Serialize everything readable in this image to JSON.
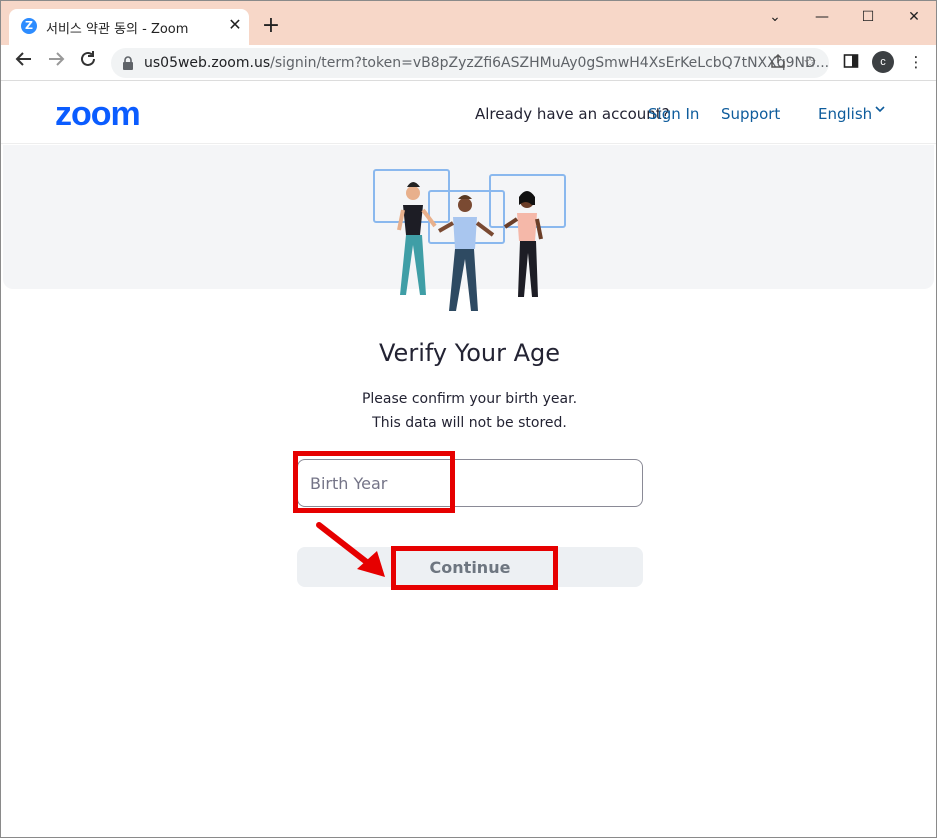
{
  "browser": {
    "tab_title": "서비스 약관 동의 - Zoom",
    "tab_favicon_letter": "Z",
    "url_domain": "us05web.zoom.us",
    "url_path": "/signin/term?token=vB8pZyzZfi6ASZHMuAy0gSmwH4XsErKeLcbQ7tNXXq9ND...",
    "profile_initial": "c",
    "icons": {
      "back": "arrow-left-icon",
      "forward": "arrow-right-icon",
      "reload": "reload-icon",
      "lock": "lock-icon",
      "share": "share-icon",
      "bookmark": "star-icon",
      "sidepanel": "side-panel-icon",
      "menu": "kebab-menu-icon"
    }
  },
  "header": {
    "logo": "zoom",
    "account_prompt": "Already have an account?",
    "sign_in": "Sign In",
    "support": "Support",
    "language": "English"
  },
  "main": {
    "title": "Verify Your Age",
    "line1": "Please confirm your birth year.",
    "line2": "This data will not be stored.",
    "birth_year_placeholder": "Birth Year",
    "continue_label": "Continue"
  },
  "colors": {
    "brand_blue": "#0b5cff",
    "link": "#0e5c9c",
    "annotation_red": "#e60000",
    "tab_strip": "#f7d7c8"
  }
}
